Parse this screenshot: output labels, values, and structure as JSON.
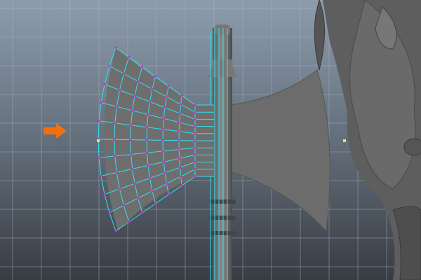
{
  "viewport": {
    "colors": {
      "bg_top": "#8d9cad",
      "bg_bottom": "#383c43",
      "grid": "#a8b3bf",
      "mesh": "#6e6e6e",
      "wire": "#33e0ee",
      "vertex": "#e020e0",
      "pivot": "#f0f000",
      "arrow": "#f07010",
      "character": "#5a5a5a"
    }
  }
}
